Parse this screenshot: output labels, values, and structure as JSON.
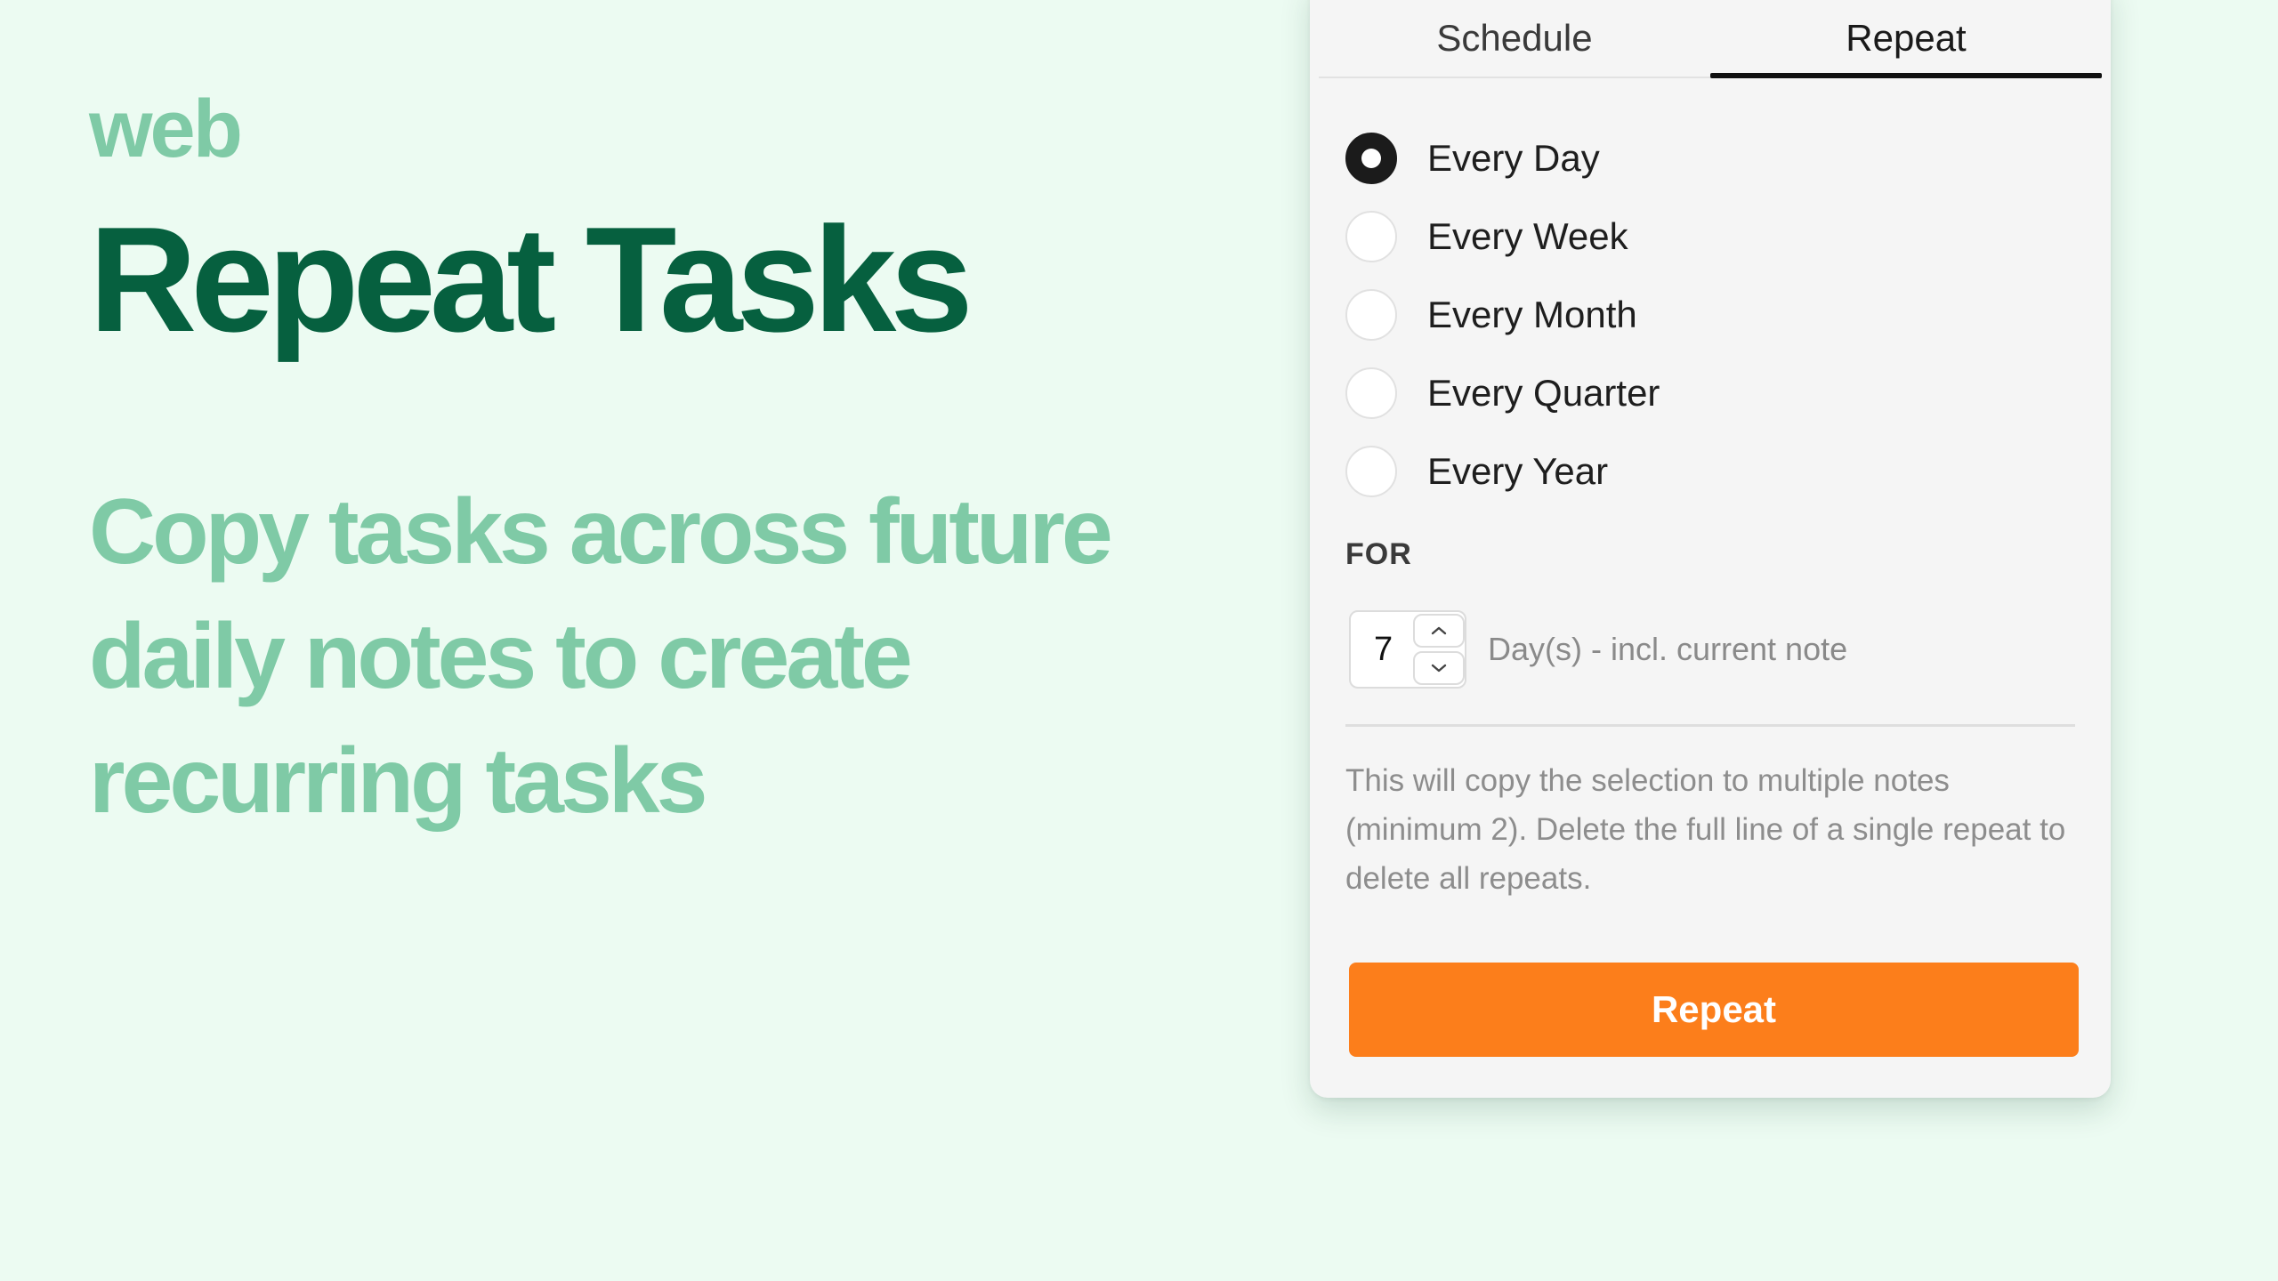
{
  "hero": {
    "eyebrow": "web",
    "headline": "Repeat Tasks",
    "subhead": "Copy tasks across future daily notes to create recurring tasks"
  },
  "panel": {
    "tabs": [
      {
        "label": "Schedule",
        "active": false
      },
      {
        "label": "Repeat",
        "active": true
      }
    ],
    "options": [
      {
        "label": "Every Day",
        "checked": true
      },
      {
        "label": "Every Week",
        "checked": false
      },
      {
        "label": "Every Month",
        "checked": false
      },
      {
        "label": "Every Quarter",
        "checked": false
      },
      {
        "label": "Every Year",
        "checked": false
      }
    ],
    "for_label": "FOR",
    "stepper": {
      "value": "7",
      "up_icon": "chevron-up-icon",
      "down_icon": "chevron-down-icon"
    },
    "unit_text": "Day(s) - incl. current note",
    "helper_text": "This will copy the selection to multiple notes (minimum 2). Delete the full line of a single repeat to delete all repeats.",
    "button_label": "Repeat"
  },
  "colors": {
    "background": "#ecfbf2",
    "headline": "#06603f",
    "accent_text": "#7fcaa6",
    "primary_button": "#fc7e1b"
  }
}
